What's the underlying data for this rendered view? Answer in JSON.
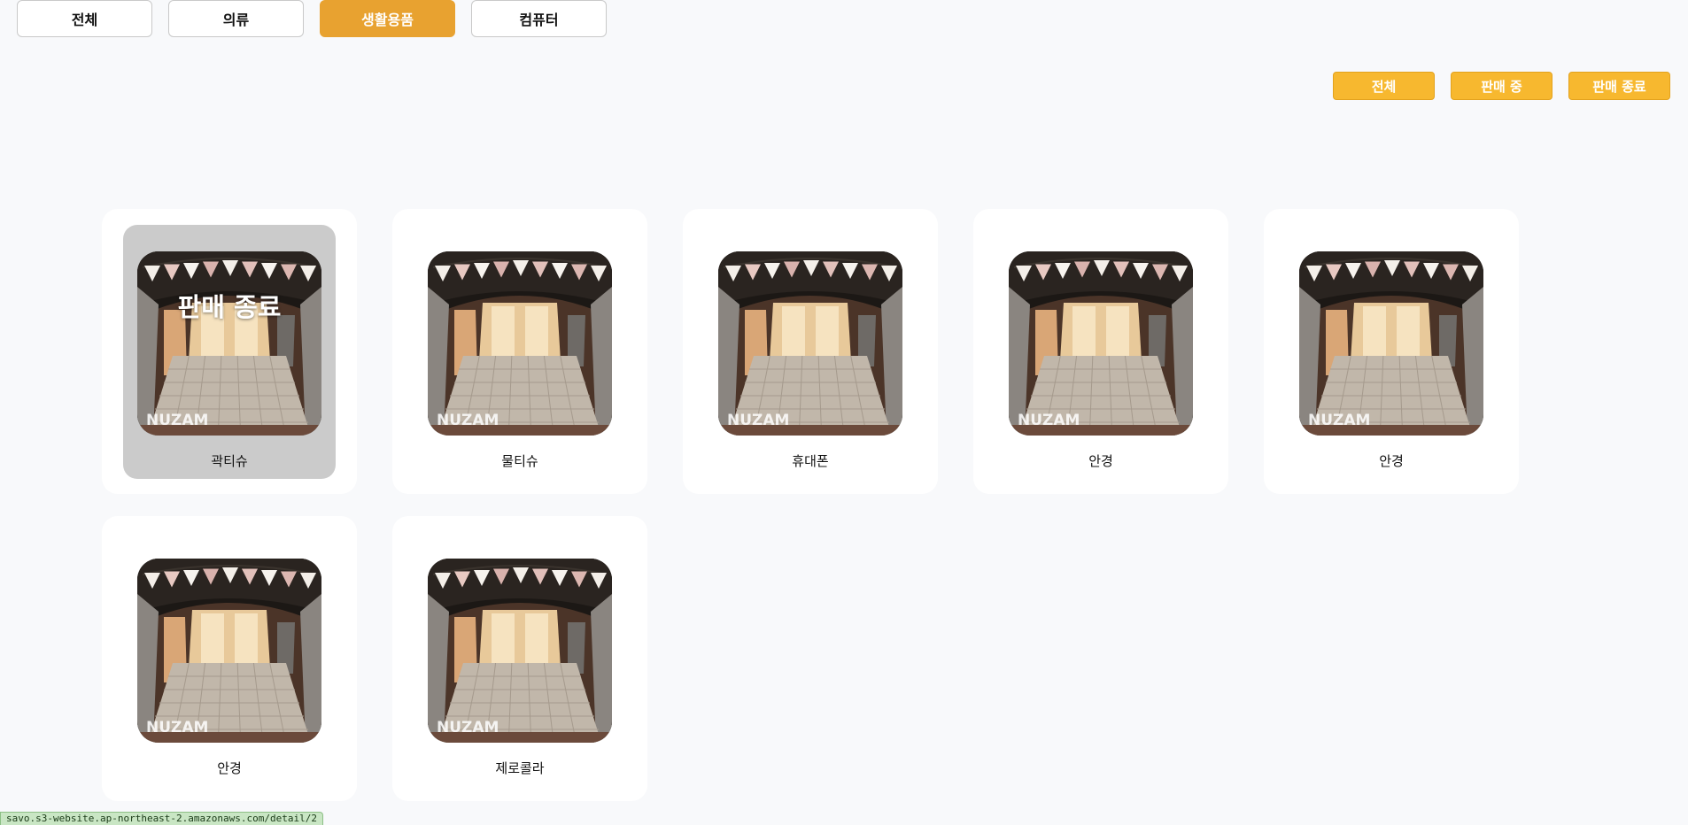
{
  "categories": [
    {
      "label": "전체",
      "active": false
    },
    {
      "label": "의류",
      "active": false
    },
    {
      "label": "생활용품",
      "active": true
    },
    {
      "label": "컴퓨터",
      "active": false
    }
  ],
  "status_filters": [
    "전체",
    "판매 중",
    "판매 종료"
  ],
  "products": [
    {
      "name": "곽티슈",
      "ended": true,
      "overlay": "판매 종료",
      "brand": "NUZAM"
    },
    {
      "name": "물티슈",
      "ended": false,
      "brand": "NUZAM"
    },
    {
      "name": "휴대폰",
      "ended": false,
      "brand": "NUZAM"
    },
    {
      "name": "안경",
      "ended": false,
      "brand": "NUZAM"
    },
    {
      "name": "안경",
      "ended": false,
      "brand": "NUZAM"
    },
    {
      "name": "안경",
      "ended": false,
      "brand": "NUZAM"
    },
    {
      "name": "제로콜라",
      "ended": false,
      "brand": "NUZAM"
    }
  ],
  "status_url": "savo.s3-website.ap-northeast-2.amazonaws.com/detail/2",
  "colors": {
    "accent": "#e8a230",
    "filter": "#f7b82f"
  }
}
